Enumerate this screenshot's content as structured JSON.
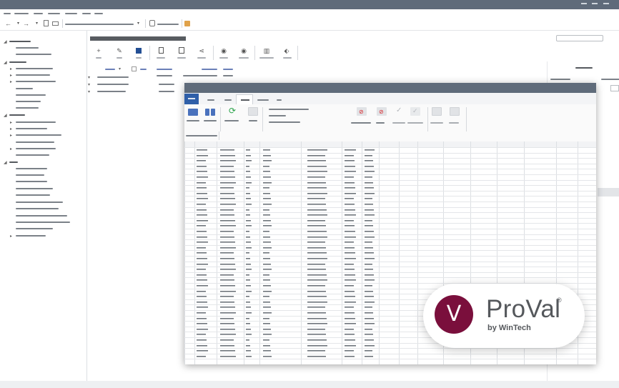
{
  "app": {
    "window_controls": [
      "minimize",
      "maximize",
      "close"
    ]
  },
  "colors": {
    "titlebar": "#5f6b7a",
    "accent": "#2f5fa8",
    "logo_circle": "#7a0f3c",
    "logo_text": "#55585c"
  },
  "icons": {
    "back": "arrow-left-icon",
    "forward": "arrow-right-icon",
    "add": "plus-icon",
    "edit": "pencil-icon",
    "run": "play-icon",
    "share": "share-icon",
    "hide": "eye-off-icon",
    "view": "eye-icon",
    "book": "book-icon",
    "tag": "tag-icon",
    "refresh": "refresh-icon",
    "deny": "no-entry-icon",
    "check": "check-icon"
  },
  "glyphs": {
    "back": "←",
    "forward": "→",
    "caret": "▾",
    "plus": "+",
    "pencil": "✎",
    "play": "▶",
    "share": "⋖",
    "eye": "◉",
    "book": "▥",
    "tag": "⬖",
    "refresh": "⟳",
    "deny": "⊘",
    "check": "✓",
    "expand": "▸",
    "collapse": "◢"
  },
  "logo": {
    "letter": "V",
    "name": "ProVal",
    "registered": "®",
    "byline": "by WinTech"
  }
}
